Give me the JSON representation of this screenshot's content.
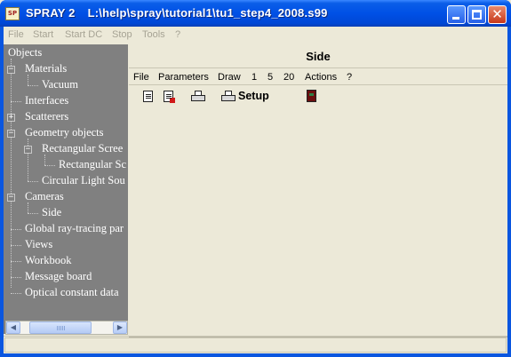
{
  "window": {
    "app_name": "SPRAY 2",
    "file_path": "L:\\help\\spray\\tutorial1\\tu1_step4_2008.s99",
    "icon_label": "SP",
    "close_glyph": "✕"
  },
  "menubar": {
    "items": [
      "File",
      "Start",
      "Start DC",
      "Stop",
      "Tools",
      "?"
    ]
  },
  "tree": {
    "root": "Objects",
    "materials": "Materials",
    "vacuum": "Vacuum",
    "interfaces": "Interfaces",
    "scatterers": "Scatterers",
    "geometry_objects": "Geometry objects",
    "rectangular_screen": "Rectangular Scree",
    "rectangular_sub": "Rectangular Sc",
    "circular_light": "Circular Light Sou",
    "cameras": "Cameras",
    "side": "Side",
    "global_ray": "Global ray-tracing par",
    "views": "Views",
    "workbook": "Workbook",
    "message_board": "Message board",
    "optical_constant": "Optical constant data"
  },
  "scrollbar": {
    "left_arrow": "◀",
    "right_arrow": "▶"
  },
  "panel": {
    "title": "Side",
    "submenu": [
      "File",
      "Parameters",
      "Draw",
      "1",
      "5",
      "20",
      "Actions",
      "?"
    ],
    "toolbar": {
      "setup_label": "Setup"
    }
  }
}
